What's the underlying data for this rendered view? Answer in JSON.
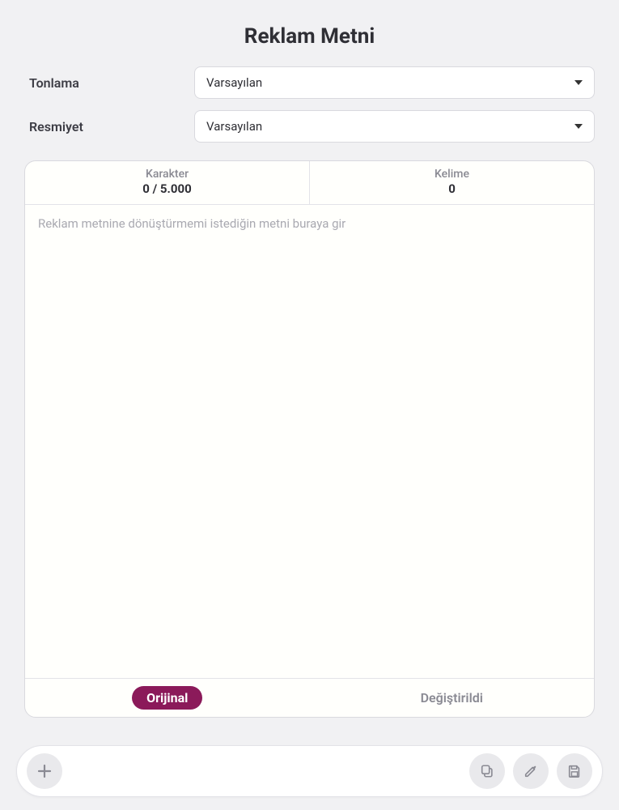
{
  "page": {
    "title": "Reklam Metni"
  },
  "form": {
    "tone_label": "Tonlama",
    "tone_value": "Varsayılan",
    "formality_label": "Resmiyet",
    "formality_value": "Varsayılan"
  },
  "stats": {
    "char_label": "Karakter",
    "char_value": "0 / 5.000",
    "word_label": "Kelime",
    "word_value": "0"
  },
  "editor": {
    "placeholder": "Reklam metnine dönüştürmemi istediğin metni buraya gir"
  },
  "tabs": {
    "original": "Orijinal",
    "changed": "Değiştirildi"
  }
}
